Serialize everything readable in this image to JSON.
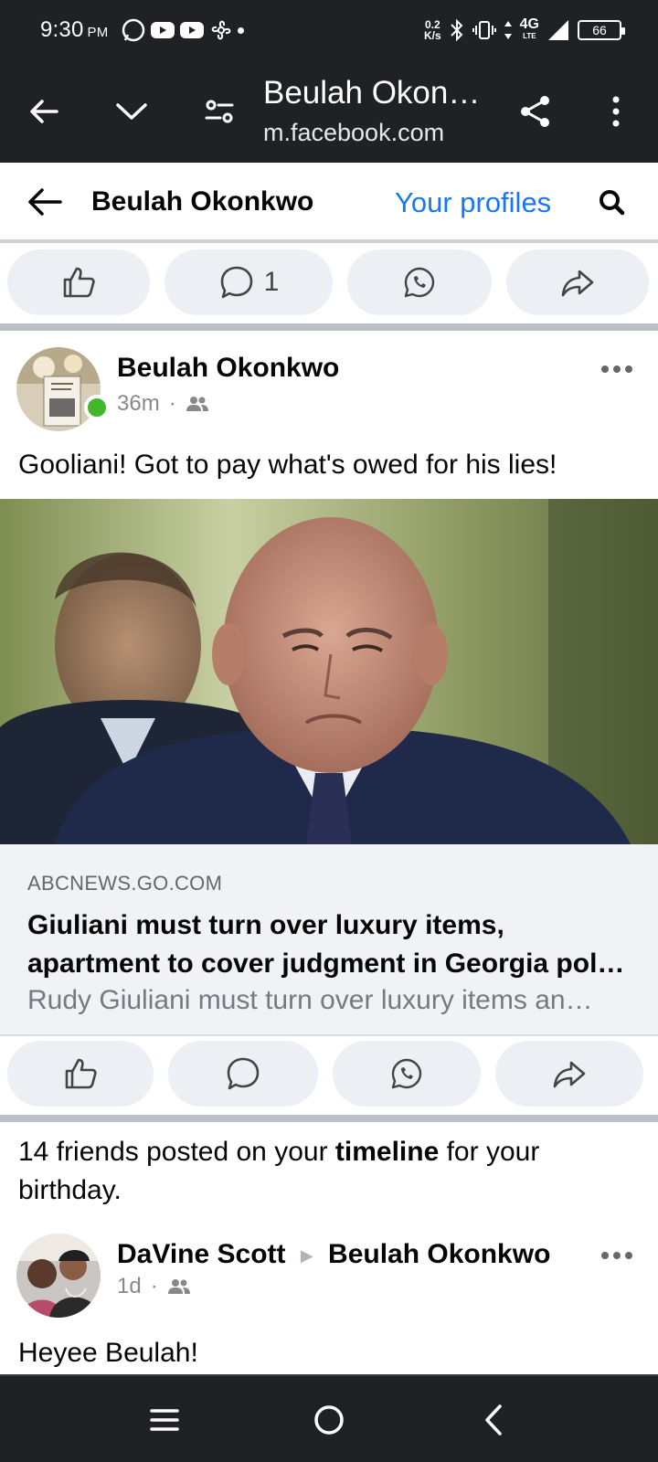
{
  "status_bar": {
    "time": "9:30",
    "ampm": "PM",
    "net_speed_value": "0.2",
    "net_speed_unit": "K/s",
    "network": "4G",
    "network_sub": "LTE",
    "battery": "66"
  },
  "browser": {
    "title": "Beulah Okon…",
    "url": "m.facebook.com"
  },
  "fb_header": {
    "name": "Beulah Okonkwo",
    "profiles_link": "Your profiles"
  },
  "top_actions": {
    "comment_count": "1"
  },
  "post1": {
    "author": "Beulah Okonkwo",
    "time": "36m",
    "separator": "·",
    "text": "Gooliani! Got to pay what's owed for his lies!",
    "link": {
      "domain": "ABCNEWS.GO.COM",
      "title_line1": "Giuliani must turn over luxury items,",
      "title_line2": "apartment to cover judgment in Georgia poll…",
      "description": "Rudy Giuliani must turn over luxury items an…"
    }
  },
  "birthday_section": {
    "pre": "14 friends posted on your ",
    "bold": "timeline",
    "post": " for your birthday."
  },
  "post2": {
    "author": "DaVine Scott",
    "arrow": "▶",
    "target": "Beulah Okonkwo",
    "time": "1d",
    "separator": "·",
    "text": "Heyee Beulah!"
  },
  "colors": {
    "fb_blue": "#1877f2",
    "system_bar": "#202124",
    "pill_bg": "#eceff3",
    "online": "#42b72a"
  }
}
